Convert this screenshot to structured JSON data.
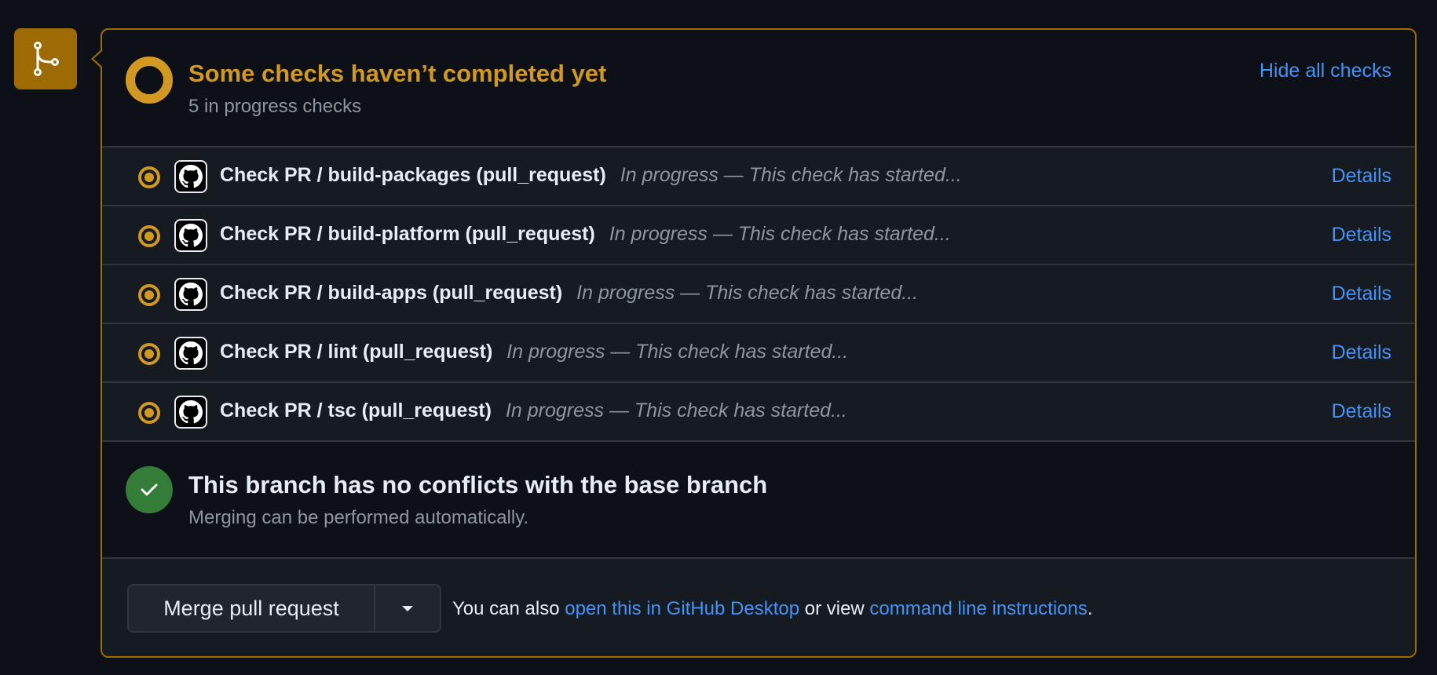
{
  "icons": {
    "branch": "git-merge-icon",
    "pending": "pending-ring-icon",
    "in_progress": "in-progress-dot-icon",
    "app": "github-mark-icon",
    "success": "check-icon",
    "dropdown": "triangle-down-icon"
  },
  "colors": {
    "warning": "#d29922",
    "badge": "#9e6a03",
    "success": "#347d39",
    "link": "#4493f8"
  },
  "checks_header": {
    "title": "Some checks haven’t completed yet",
    "subtitle": "5 in progress checks",
    "toggle_label": "Hide all checks"
  },
  "checks": [
    {
      "name": "Check PR / build-packages (pull_request)",
      "status": "In progress — This check has started...",
      "details": "Details"
    },
    {
      "name": "Check PR / build-platform (pull_request)",
      "status": "In progress — This check has started...",
      "details": "Details"
    },
    {
      "name": "Check PR / build-apps (pull_request)",
      "status": "In progress — This check has started...",
      "details": "Details"
    },
    {
      "name": "Check PR / lint (pull_request)",
      "status": "In progress — This check has started...",
      "details": "Details"
    },
    {
      "name": "Check PR / tsc (pull_request)",
      "status": "In progress — This check has started...",
      "details": "Details"
    }
  ],
  "merge_status": {
    "title": "This branch has no conflicts with the base branch",
    "subtitle": "Merging can be performed automatically."
  },
  "actions": {
    "merge_label": "Merge pull request",
    "hint_prefix": "You can also ",
    "desktop_link": "open this in GitHub Desktop",
    "hint_middle": " or view ",
    "cli_link": "command line instructions",
    "hint_suffix": "."
  }
}
